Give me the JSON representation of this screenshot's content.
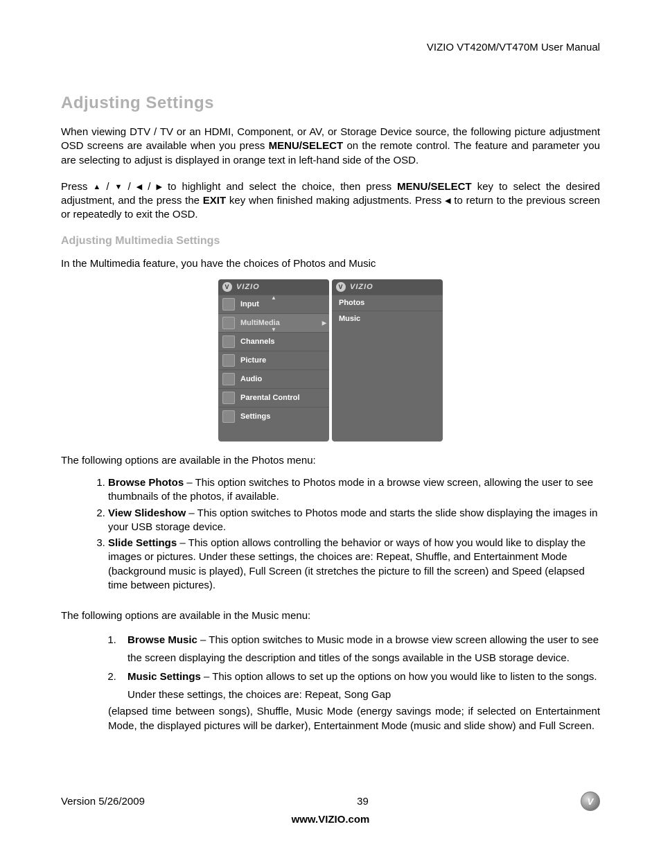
{
  "header": {
    "right": "VIZIO VT420M/VT470M User Manual"
  },
  "h1": "Adjusting Settings",
  "p1_before": "When viewing DTV / TV or an HDMI, Component, or AV, or Storage Device source, the following picture adjustment OSD screens are available when you press ",
  "p1_bold": "MENU/SELECT",
  "p1_after": " on the remote control. The feature and parameter you are selecting to adjust is displayed in orange text in left-hand side of the OSD.",
  "p2_a": "Press ",
  "p2_tri1": "▲",
  "p2_slash": " / ",
  "p2_tri2": "▼",
  "p2_tri3": "◀",
  "p2_tri4": "▶",
  "p2_b": " to highlight and select the choice, then press ",
  "p2_bold1": "MENU/SELECT",
  "p2_c": " key to select the desired adjustment, and the press the ",
  "p2_bold2": "EXIT",
  "p2_d": " key when finished making adjustments. Press ",
  "p2_tri5": "◀",
  "p2_e": " to return to the previous screen or repeatedly to exit the OSD.",
  "h2": "Adjusting Multimedia Settings",
  "p3": "In the Multimedia feature, you have the choices of Photos and Music",
  "osd": {
    "brand": "VIZIO",
    "left": [
      {
        "label": "Input"
      },
      {
        "label": "MultiMedia",
        "selected": true
      },
      {
        "label": "Channels"
      },
      {
        "label": "Picture"
      },
      {
        "label": "Audio"
      },
      {
        "label": "Parental Control"
      },
      {
        "label": "Settings"
      }
    ],
    "right": [
      {
        "label": "Photos"
      },
      {
        "label": "Music"
      }
    ]
  },
  "p4": "The following options are available in the Photos menu:",
  "photo_opts": [
    {
      "title": "Browse Photos",
      "sep": " – ",
      "desc": "This option switches to Photos mode in a browse view screen, allowing the user to see thumbnails of the photos, if available."
    },
    {
      "title": "View Slideshow",
      "sep": " – ",
      "desc": "This option switches to Photos mode and starts the slide show displaying the images in your USB storage device."
    },
    {
      "title": "Slide Settings",
      "sep": " – ",
      "desc": "This option allows controlling the behavior or ways of how you would like to display the images or pictures. Under these settings, the choices are: Repeat, Shuffle, and Entertainment Mode (background music is played), Full Screen (it stretches the picture to fill the screen) and Speed (elapsed time between pictures)."
    }
  ],
  "p5": "The following options are available in the Music menu:",
  "music_opts": [
    {
      "title": "Browse Music",
      "sep": " – ",
      "desc": "This option switches to Music mode in a browse view screen allowing the user to see the screen displaying the description and titles of the songs available in the USB storage device."
    },
    {
      "title": "Music Settings",
      "sep": " – ",
      "desc": "This option allows to set up the options on how you would like to listen to the songs. Under these settings, the choices are: Repeat, Song Gap"
    }
  ],
  "music_trail": "(elapsed time between songs), Shuffle, Music Mode (energy savings mode; if selected on Entertainment Mode, the displayed pictures will be darker), Entertainment Mode (music and slide show) and Full Screen.",
  "footer": {
    "version": "Version 5/26/2009",
    "page": "39",
    "url": "www.VIZIO.com"
  }
}
